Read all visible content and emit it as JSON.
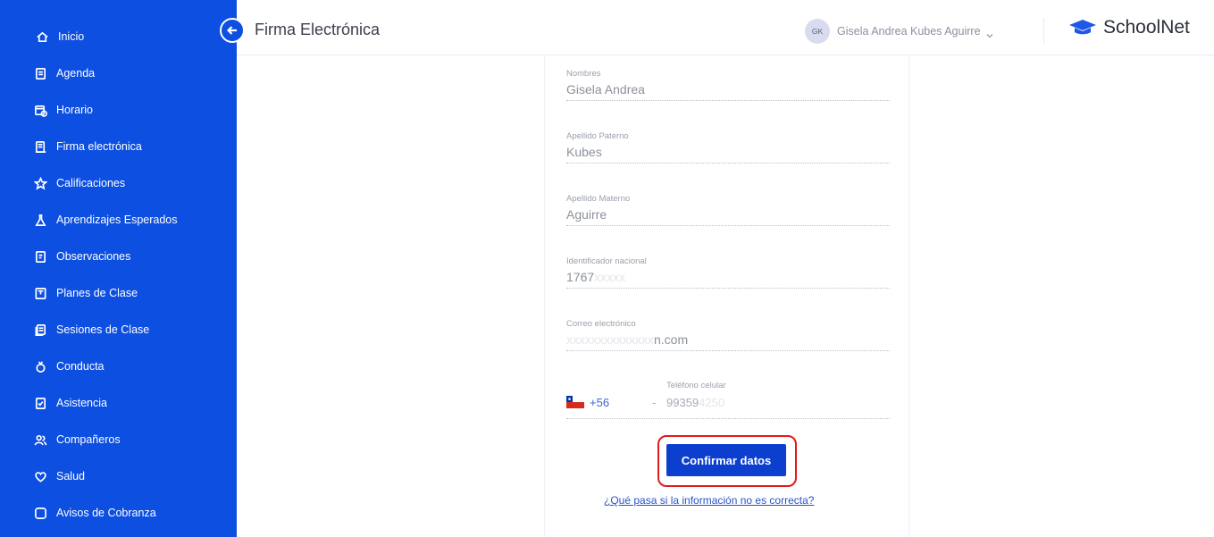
{
  "sidebar": {
    "items": [
      {
        "label": "Inicio",
        "icon": "home-icon"
      },
      {
        "label": "Agenda",
        "icon": "agenda-icon"
      },
      {
        "label": "Horario",
        "icon": "calendar-clock-icon"
      },
      {
        "label": "Firma electrónica",
        "icon": "signature-doc-icon"
      },
      {
        "label": "Calificaciones",
        "icon": "star-icon"
      },
      {
        "label": "Aprendizajes Esperados",
        "icon": "flask-icon"
      },
      {
        "label": "Observaciones",
        "icon": "note-icon"
      },
      {
        "label": "Planes de Clase",
        "icon": "plan-icon"
      },
      {
        "label": "Sesiones de Clase",
        "icon": "sessions-icon"
      },
      {
        "label": "Conducta",
        "icon": "conduct-icon"
      },
      {
        "label": "Asistencia",
        "icon": "attendance-icon"
      },
      {
        "label": "Compañeros",
        "icon": "people-icon"
      },
      {
        "label": "Salud",
        "icon": "heart-icon"
      },
      {
        "label": "Avisos de Cobranza",
        "icon": "square-icon"
      }
    ]
  },
  "header": {
    "title": "Firma Electrónica",
    "user_initials": "GK",
    "user_name": "Gisela Andrea Kubes Aguirre",
    "brand": "SchoolNet"
  },
  "form": {
    "fields": [
      {
        "label": "Nombres",
        "value": "Gisela Andrea"
      },
      {
        "label": "Apellido Paterno",
        "value": "Kubes"
      },
      {
        "label": "Apellido Materno",
        "value": "Aguirre"
      },
      {
        "label": "Identificador nacional",
        "value": "1767",
        "value_hidden": "xxxxx"
      },
      {
        "label": "Correo electrónico",
        "value_hidden": "xxxxxxxxxxxxxx",
        "value": "n.com"
      }
    ],
    "phone": {
      "label": "Teléfono celular",
      "country_code": "+56",
      "value": "99359",
      "value_hidden": "4250"
    },
    "confirm_label": "Confirmar datos",
    "help_link": "¿Qué pasa si la información no es correcta?"
  },
  "colors": {
    "sidebar_bg": "#0d4fe0",
    "button_bg": "#0d3fcf",
    "highlight": "#e01b1b"
  }
}
